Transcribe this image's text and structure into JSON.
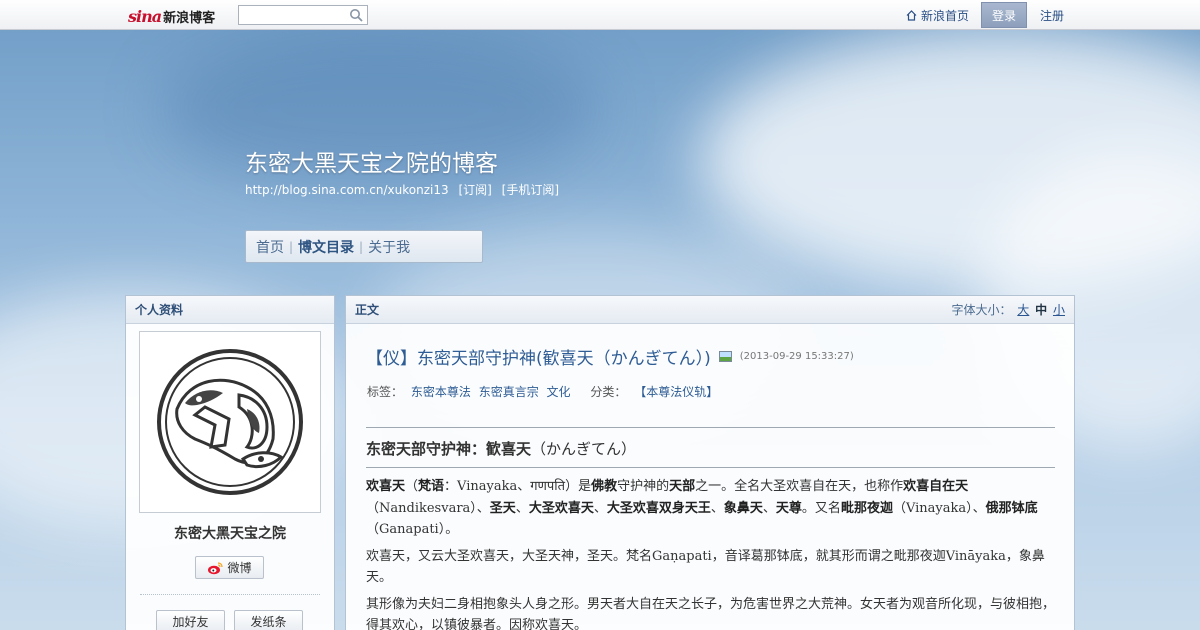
{
  "topbar": {
    "logo_sina": "sina",
    "logo_text": "新浪博客",
    "search_placeholder": "",
    "home_link": "新浪首页",
    "login": "登录",
    "register": "注册"
  },
  "header": {
    "title": "东密大黑天宝之院的博客",
    "url": "http://blog.sina.com.cn/xukonzi13",
    "subscribe": "[订阅]",
    "mobile_subscribe": "[手机订阅]"
  },
  "nav": {
    "items": [
      {
        "label": "首页"
      },
      {
        "label": "博文目录"
      },
      {
        "label": "关于我"
      }
    ]
  },
  "profile": {
    "heading": "个人资料",
    "name": "东密大黑天宝之院",
    "weibo": "微博",
    "add_friend": "加好友",
    "send_note": "发纸条"
  },
  "article": {
    "heading": "正文",
    "font_size_label": "字体大小：",
    "font_large": "大",
    "font_medium": "中",
    "font_small": "小",
    "title": "【仪】东密天部守护神(歓喜天（かんぎてん）)",
    "time": "(2013-09-29 15:33:27)",
    "tags_label": "标签：",
    "tags": [
      "东密本尊法",
      "东密真言宗",
      "文化"
    ],
    "category_label": "分类：",
    "category": "【本尊法仪轨】",
    "section_heading_bold": "东密天部守护神：歓喜天",
    "section_heading_rest": "（かんぎてん）",
    "p1": {
      "s1": "欢喜天",
      "s2": "（",
      "s3": "梵语",
      "s4": "：Vinayaka、गणपति）是",
      "s5": "佛教",
      "s6": "守护神的",
      "s7": "天部",
      "s8": "之一。全名大圣欢喜自在天，也称作",
      "s9": "欢喜自在天",
      "s10": "（Nandikesvara）、",
      "s11": "圣天",
      "s12": "、",
      "s13": "大圣欢喜天",
      "s14": "、",
      "s15": "大圣欢喜双身天王",
      "s16": "、",
      "s17": "象鼻天",
      "s18": "、",
      "s19": "天尊",
      "s20": "。又名",
      "s21": "毗那夜迦",
      "s22": "（Vinayaka）、",
      "s23": "俄那钵底",
      "s24": "（Ganapati）。"
    },
    "p2": "欢喜天，又云大圣欢喜天，大圣天神，圣天。梵名Gaṇapati，音译葛那钵底，就其形而谓之毗那夜迦Vināyaka，象鼻天。",
    "p3": "其形像为夫妇二身相抱象头人身之形。男天者大自在天之长子，为危害世界之大荒神。女天者为观音所化现，与彼相抱，得其欢心，以镇彼暴者。因称欢喜天。"
  },
  "colors": {
    "link": "#2e5c94",
    "accent_red": "#c8102e",
    "login_bg": "#8d9fbc"
  }
}
